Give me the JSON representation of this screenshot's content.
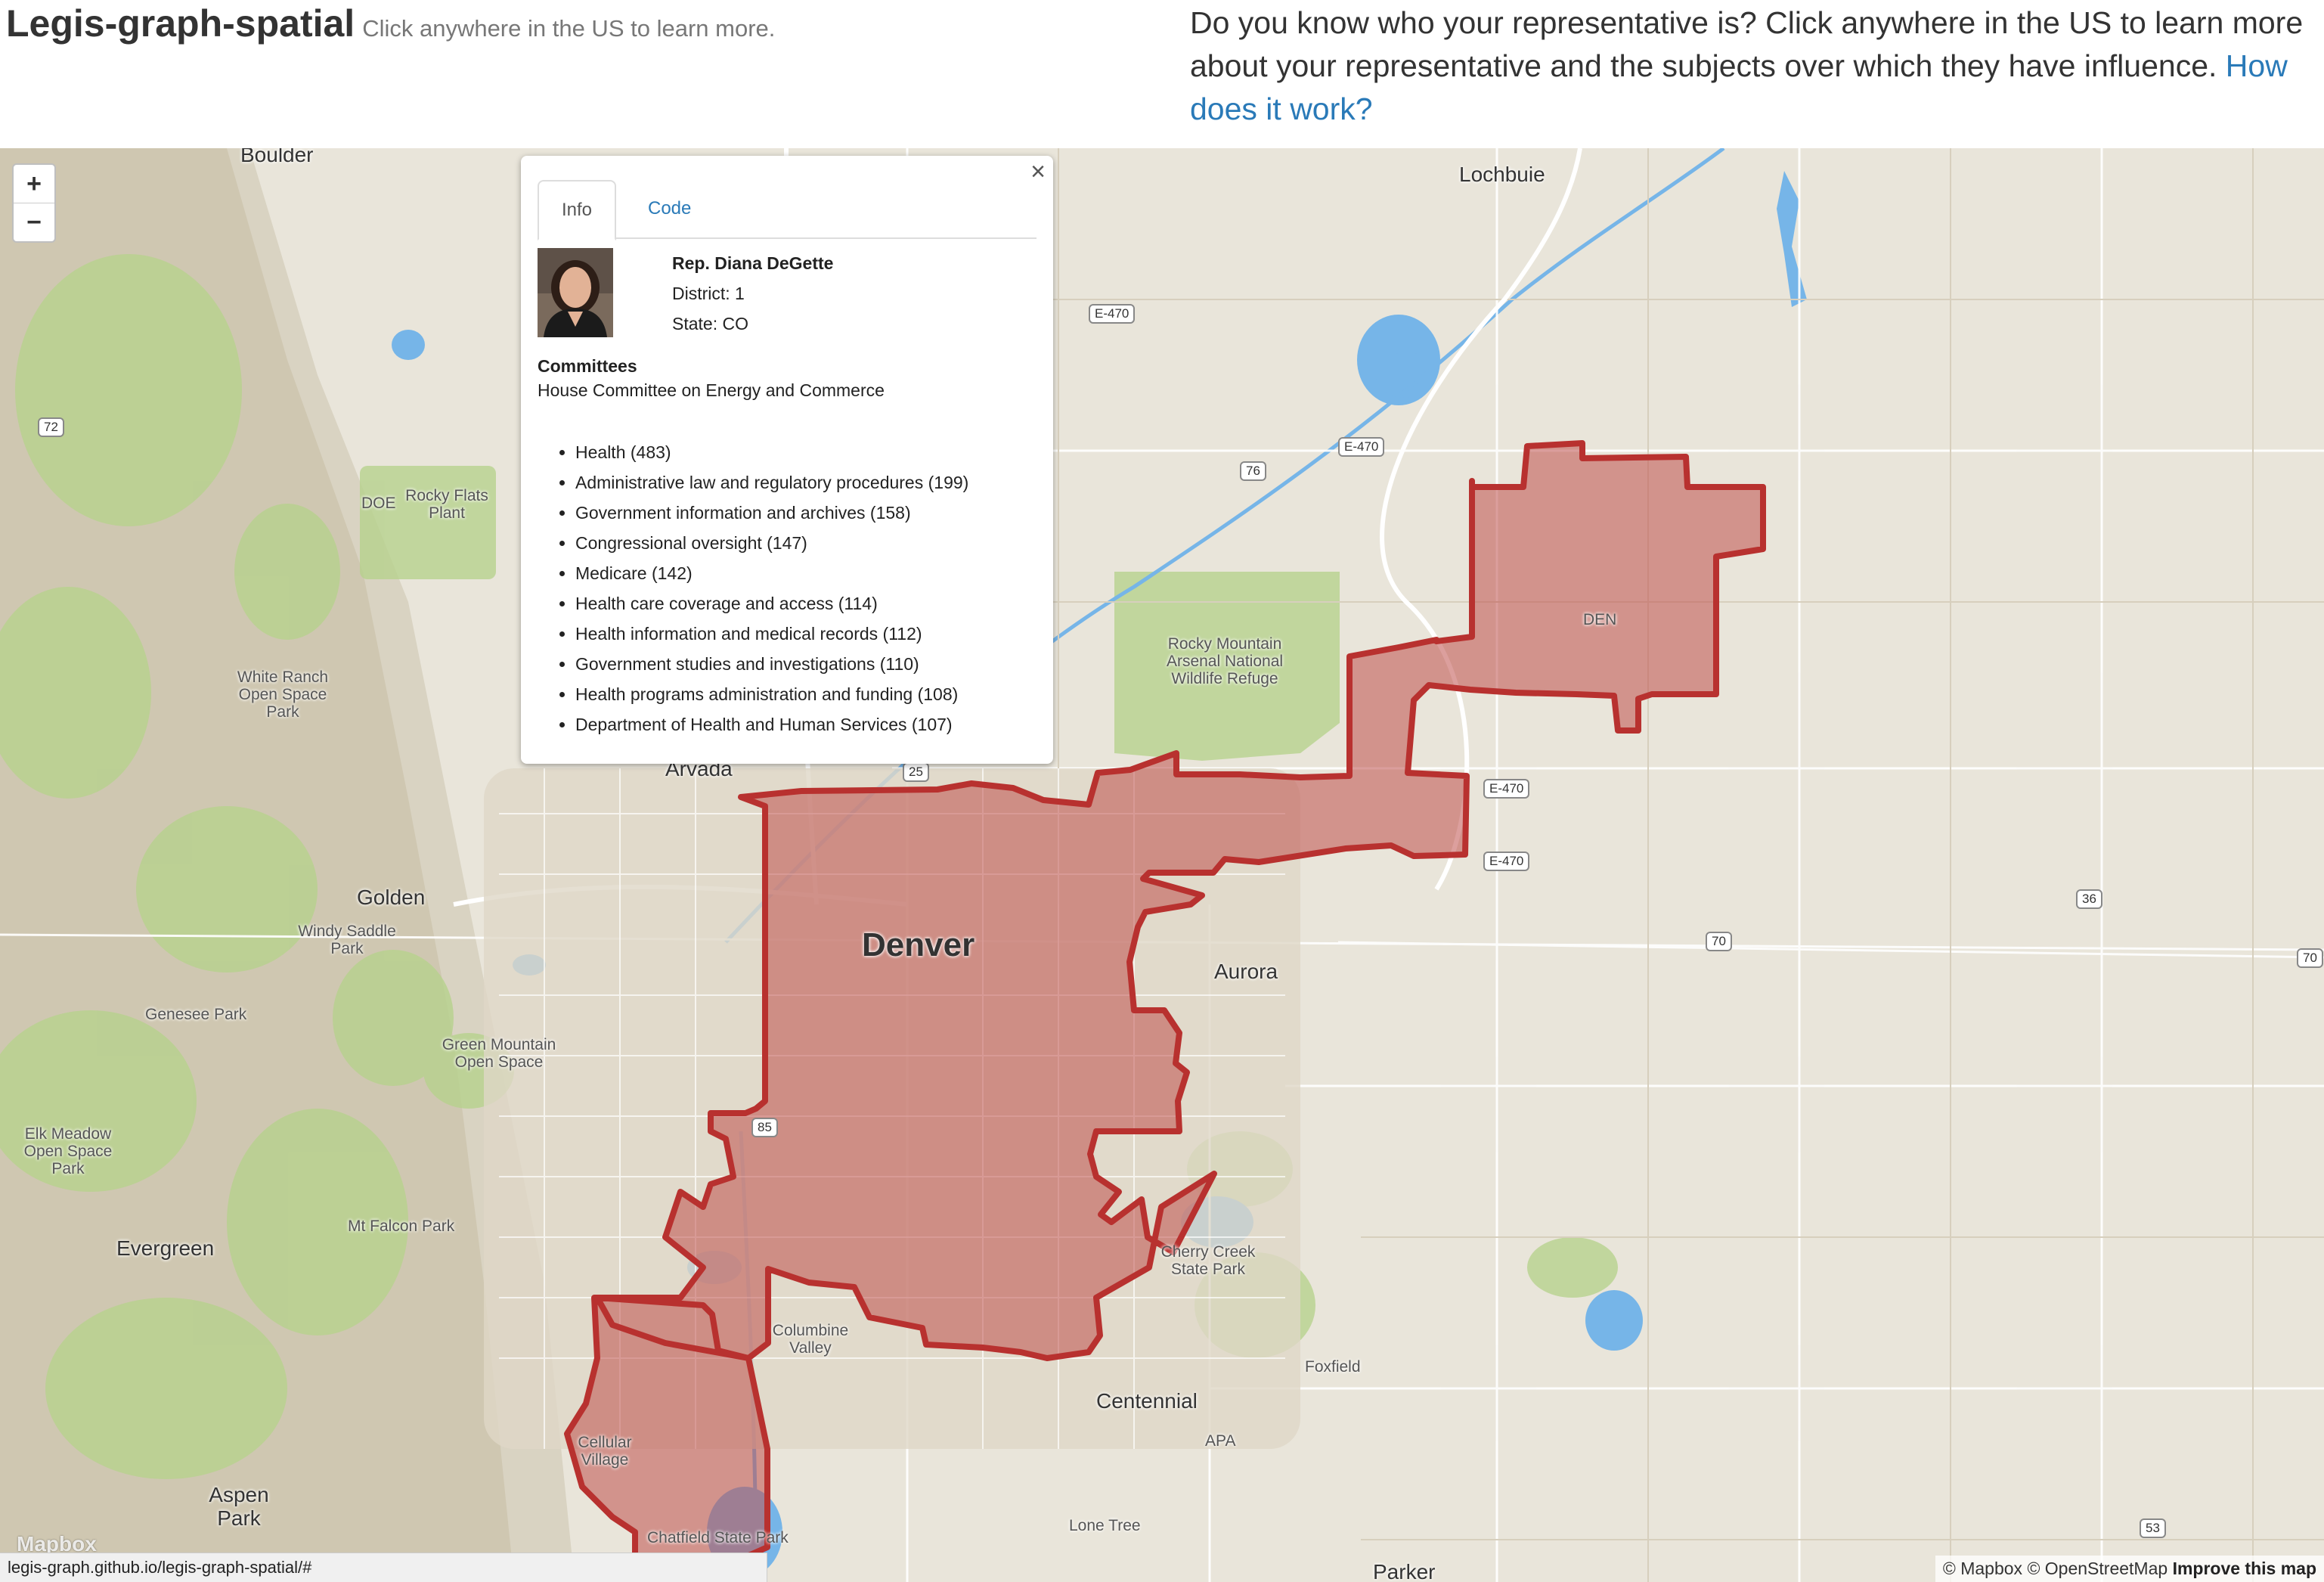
{
  "header": {
    "title": "Legis-graph-spatial",
    "tagline": "Click anywhere in the US to learn more.",
    "intro_text": "Do you know who your representative is? Click anywhere in the US to learn more about your representative and the subjects over which they have influence.",
    "how_link": "How does it work?"
  },
  "map": {
    "zoom_in": "+",
    "zoom_out": "−",
    "labels": {
      "boulder": "Boulder",
      "lochbuie": "Lochbuie",
      "rocky_flats": "Rocky Flats Plant",
      "doe": "DOE",
      "white_ranch": "White Ranch Open Space Park",
      "arsenal": "Rocky Mountain Arsenal National Wildlife Refuge",
      "den": "DEN",
      "arvada": "Arvada",
      "golden": "Golden",
      "windy_saddle": "Windy Saddle Park",
      "denver": "Denver",
      "aurora": "Aurora",
      "genesee": "Genesee Park",
      "green_mountain": "Green Mountain Open Space",
      "elk_meadow": "Elk Meadow Open Space Park",
      "mt_falcon": "Mt Falcon Park",
      "evergreen": "Evergreen",
      "cherry_creek": "Cherry Creek State Park",
      "columbine": "Columbine Valley",
      "foxfield": "Foxfield",
      "centennial": "Centennial",
      "apa": "APA",
      "cellular_village": "Cellular Village",
      "aspen_park": "Aspen Park",
      "lone_tree": "Lone Tree",
      "chatfield": "Chatfield State Park",
      "parker": "Parker"
    },
    "shields": {
      "e470_a": "E-470",
      "e470_b": "E-470",
      "e470_c": "E-470",
      "e470_d": "E-470",
      "i76": "76",
      "i25": "25",
      "i70_a": "70",
      "i70_b": "70",
      "co72": "72",
      "us36": "36",
      "us85": "85",
      "co53": "53"
    },
    "mapbox_logo": "Mapbox",
    "attribution": {
      "mapbox": "© Mapbox",
      "osm": "© OpenStreetMap",
      "improve": "Improve this map"
    },
    "status_url": "legis-graph.github.io/legis-graph-spatial/#",
    "colors": {
      "district_fill": "#c0504d",
      "district_stroke": "#b8312f",
      "water": "#76b5e8",
      "park": "#b9d88f"
    }
  },
  "popup": {
    "close": "×",
    "tabs": [
      "Info",
      "Code"
    ],
    "rep": {
      "name": "Rep. Diana DeGette",
      "district": "District: 1",
      "state": "State: CO"
    },
    "committees_heading": "Committees",
    "committee": "House Committee on Energy and Commerce",
    "subjects": [
      "Health (483)",
      "Administrative law and regulatory procedures (199)",
      "Government information and archives (158)",
      "Congressional oversight (147)",
      "Medicare (142)",
      "Health care coverage and access (114)",
      "Health information and medical records (112)",
      "Government studies and investigations (110)",
      "Health programs administration and funding (108)",
      "Department of Health and Human Services (107)"
    ]
  }
}
